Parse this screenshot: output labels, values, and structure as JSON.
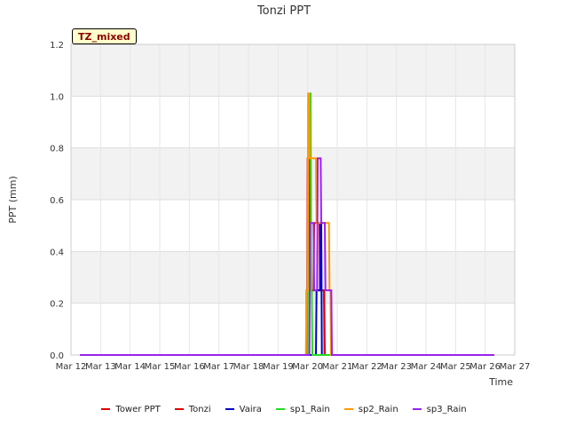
{
  "chart_data": {
    "type": "line",
    "title": "Tonzi PPT",
    "xlabel": "Time",
    "ylabel": "PPT (mm)",
    "ylim": [
      0,
      1.2
    ],
    "xlim": [
      "Mar 12",
      "Mar 27"
    ],
    "x_ticks": [
      "Mar 12",
      "Mar 13",
      "Mar 14",
      "Mar 15",
      "Mar 16",
      "Mar 17",
      "Mar 18",
      "Mar 19",
      "Mar 20",
      "Mar 21",
      "Mar 22",
      "Mar 23",
      "Mar 24",
      "Mar 25",
      "Mar 26",
      "Mar 27"
    ],
    "y_ticks": [
      "0.0",
      "0.2",
      "0.4",
      "0.6",
      "0.8",
      "1.0",
      "1.2"
    ],
    "grid": true,
    "legend_position": "bottom",
    "annotation": "TZ_mixed",
    "series": [
      {
        "name": "Tower PPT",
        "color": "#dd0000",
        "x": [
          12.3,
          19.95,
          19.96,
          20.0,
          20.02,
          20.1,
          20.12,
          20.2,
          20.22,
          20.4,
          20.42,
          20.55,
          20.57,
          26.3
        ],
        "y": [
          0,
          0,
          0.25,
          0.25,
          0.76,
          0.76,
          0.25,
          0.25,
          0.51,
          0.51,
          0.25,
          0.25,
          0,
          0
        ]
      },
      {
        "name": "Tonzi",
        "color": "#dd0000",
        "x": [
          12.3,
          19.98,
          20.0,
          20.05,
          20.07,
          20.5,
          20.52,
          20.56,
          20.58,
          26.3
        ],
        "y": [
          0,
          0,
          0.76,
          0.76,
          0.25,
          0.25,
          0.25,
          0.25,
          0,
          0
        ]
      },
      {
        "name": "Vaira",
        "color": "#0000cc",
        "x": [
          12.3,
          20.28,
          20.3,
          20.42,
          20.44,
          20.46,
          20.48,
          26.3
        ],
        "y": [
          0,
          0,
          0.25,
          0.25,
          0.51,
          0.51,
          0,
          0
        ]
      },
      {
        "name": "sp1_Rain",
        "color": "#22dd22",
        "x": [
          12.3,
          20.0,
          20.02,
          20.1,
          20.12,
          20.14,
          20.16,
          26.3
        ],
        "y": [
          0,
          0,
          1.01,
          1.01,
          0.25,
          0.25,
          0,
          0
        ]
      },
      {
        "name": "sp2_Rain",
        "color": "#ff9900",
        "x": [
          12.3,
          19.94,
          19.96,
          20.0,
          20.02,
          20.05,
          20.07,
          20.28,
          20.3,
          20.72,
          20.74,
          20.77,
          20.79,
          26.3
        ],
        "y": [
          0,
          0,
          0.25,
          0.25,
          1.01,
          1.01,
          0.76,
          0.76,
          0.51,
          0.51,
          0.25,
          0.25,
          0,
          0
        ]
      },
      {
        "name": "sp3_Rain",
        "color": "#9922ee",
        "x": [
          12.3,
          20.06,
          20.08,
          20.2,
          20.22,
          20.32,
          20.34,
          20.44,
          20.46,
          20.58,
          20.6,
          20.8,
          20.82,
          26.3
        ],
        "y": [
          0,
          0,
          0.51,
          0.51,
          0.25,
          0.25,
          0.76,
          0.76,
          0.51,
          0.51,
          0.25,
          0.25,
          0,
          0
        ]
      }
    ]
  }
}
